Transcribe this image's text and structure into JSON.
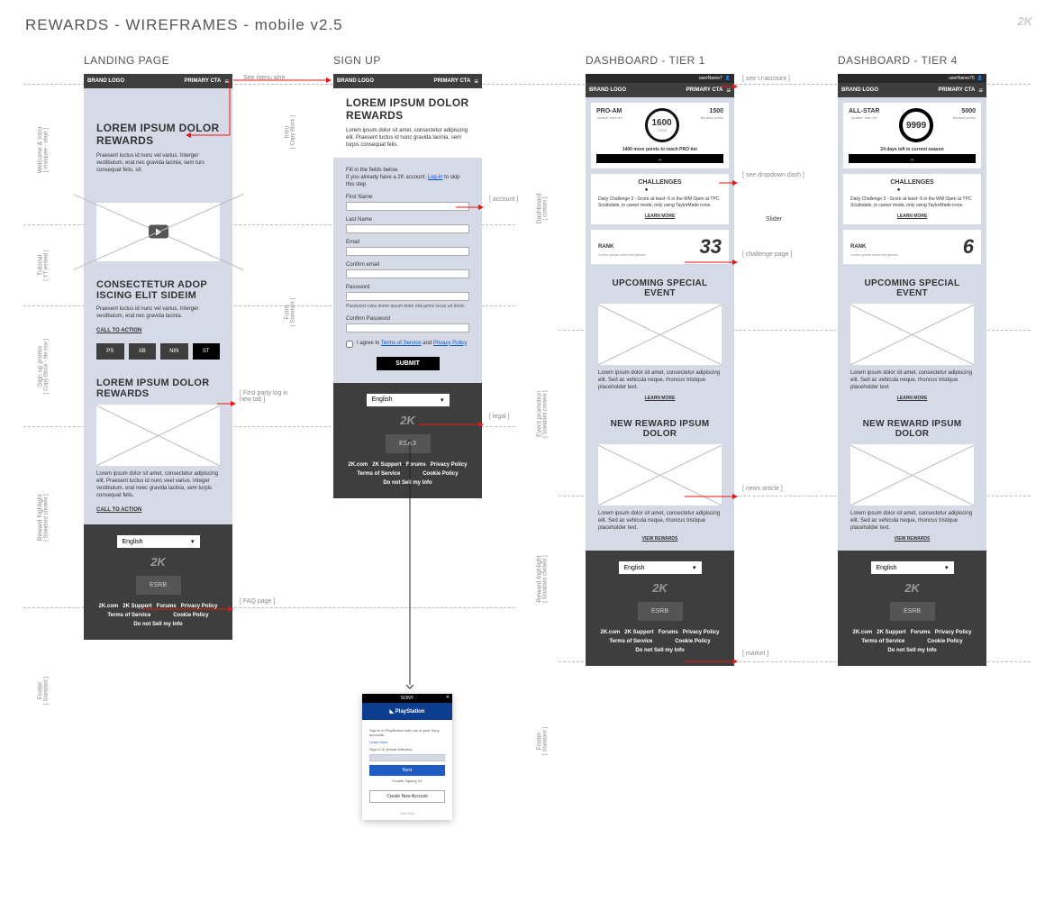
{
  "pageTitle": "REWARDS - WIREFRAMES - mobile v2.5",
  "brandLogo": "2K",
  "columns": {
    "landing": "LANDING PAGE",
    "signup": "SIGN UP",
    "dash1": "DASHBOARD - TIER 1",
    "dash4": "DASHBOARD - TIER 4"
  },
  "topbar": {
    "brand": "BRAND LOGO",
    "cta": "PRIMARY CTA"
  },
  "userbar": {
    "name1": "userName7",
    "name4": "userName75"
  },
  "landing": {
    "heroTitle": "LOREM IPSUM DOLOR REWARDS",
    "heroBody": "Praesent luctus id nunc vel varius. Interger vestibulum, erat nec gravida lacinia, sem turs consequat felis, sit.",
    "promoTitle": "CONSECTETUR ADOP ISCING ELIT SIDEIM",
    "promoBody": "Praesent luctus id nunc vel varius. Interger vestibulum, erat nec gravida lacinia.",
    "promoCta": "CALL TO ACTION",
    "platforms": [
      "PS",
      "XB",
      "NIN",
      "ST"
    ],
    "rewardTitle": "LOREM IPSUM DOLOR REWARDS",
    "rewardBody": "Lorem ipsum dolor sit amet, consectetur adipiscing elit. Praesent luctus id nunc veel varius. Integer vestibulum, erat neec gravida lacinia, sem turpis consequat felis.",
    "rewardCta": "CALL TO ACTION"
  },
  "signup": {
    "title": "LOREM IPSUM DOLOR REWARDS",
    "intro": "Lorem ipsum dolor sit amet, consectetur adipiscing elit. Praesent luctus id nunc gravida lacinia, sem turpis consequat felis.",
    "formNote1": "Fill in the fields below.",
    "formNote2a": "If you already have a 2K account, ",
    "formNote2b": "Log-in",
    "formNote2c": " to skip this step",
    "labels": {
      "first": "First Name",
      "last": "Last Name",
      "email": "Email",
      "cemail": "Confirm email",
      "pass": "Password",
      "cpass": "Confirm Password"
    },
    "passHint": "Password rules lorem ipsum dolor etta jamis lucus ud donic.",
    "agree1": "I agree to ",
    "tos": "Terms of Service",
    "agree2": " and ",
    "pp": "Privacy Policy",
    "submit": "SUBMIT"
  },
  "dash": {
    "tier1": {
      "name": "PRO-AM",
      "updated": "Upated: 5am 8/1",
      "points": "1600",
      "pointsGoal": "/ 3000",
      "banked": "1500",
      "bankedLabel": "Banked points",
      "progress": "1400 more points to reach PRO tier"
    },
    "tier4": {
      "name": "ALL-STAR",
      "updated": "Upated: 5am 8/1",
      "points": "9999",
      "banked": "5000",
      "bankedLabel": "Banked points",
      "progress": "24 days left in current season"
    },
    "dropdownIcon": "⌄",
    "challenges": {
      "title": "CHALLENGES",
      "body": "Daily Challenge 3 - Score at least -5 in the WM Open at TPC Scottsdale, in career mode, only using TaylorMade irons.",
      "learn": "LEARN MORE"
    },
    "rank": {
      "label": "RANK",
      "sub": "Lorem ipsum dolor eta jameis.",
      "v1": "33",
      "v4": "6"
    },
    "event": {
      "title": "UPCOMING SPECIAL EVENT",
      "body": "Lorem ipsum dolor sit amet, consectetur adipiscing elit. Sed ac vehicula neque, rhoncus tristique placeholder text.",
      "learn": "LEARN MORE"
    },
    "reward": {
      "title": "NEW REWARD IPSUM DOLOR",
      "body": "Lorem ipsum dolor sit amet, consectetur adipiscing elit. Sed ac vehicula neque, rhoncus tristique placeholder text.",
      "view": "VIEW REWARDS"
    }
  },
  "footer": {
    "lang": "English",
    "logo": "2K",
    "esrb": "ESRB",
    "links": [
      "2K.com",
      "2K Support",
      "Forums",
      "Privacy Policy",
      "Terms of Service",
      "Cookie Policy",
      "Do not Sell my Info"
    ]
  },
  "sideLabels": {
    "welcome": "Welcome & Intro",
    "welcomeSub": "[ marquee - short ]",
    "tutorial": "Tutorial",
    "tutorialSub": "[ YT embed ]",
    "signupPromo": "Sign up promo",
    "signupPromoSub": "[ Copy Block - tile row ]",
    "rewardHl": "Reward highlight",
    "rewardHlSub": "[ Standard content ]",
    "footer": "Footer",
    "footerSub": "[ Standard ]",
    "intro": "Intro",
    "introSub": "[ Copy Block ]",
    "form": "Form",
    "formSub": "[ Standard ]",
    "dashboard": "Dashboard",
    "dashboardSub": "[ custom ]",
    "eventPromo": "Event promotion",
    "eventPromoSub": "[ Standard content ]"
  },
  "annotations": {
    "menuWire": "See menu wire",
    "firstParty": "[ First party log in new tab ]",
    "faq": "[ FAQ page ]",
    "account": "[ account ]",
    "legal": "[ legal ]",
    "uaccount": "[ see U-account ]",
    "dropdownDash": "[ see dropdown dash ]",
    "slider": "Slider",
    "challengePage": "[ challenge page ]",
    "newsArticle": "[ news article ]",
    "market": "[ market ]"
  },
  "popup": {
    "sony": "SONY",
    "ps": "PlayStation",
    "desc": "Sign in to PlayStation with one of your Sony accounts.",
    "learn": "Learn More",
    "signin": "Sign-In ID (Email Address)",
    "btn": "Next",
    "trouble": "Trouble Signing In?",
    "create": "Create New Account",
    "foot": "Site Map"
  }
}
